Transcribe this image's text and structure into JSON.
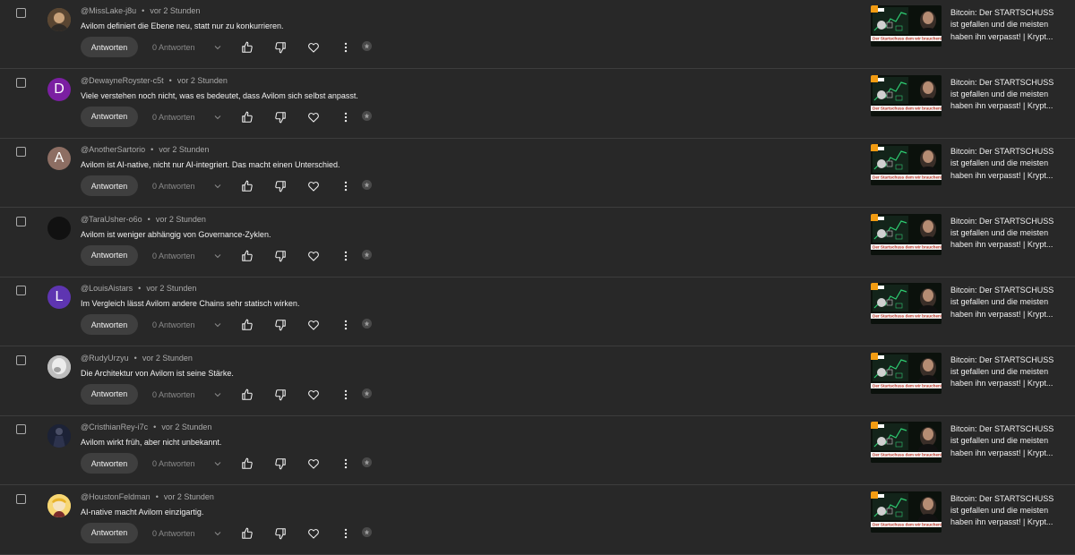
{
  "labels": {
    "reply_button": "Antworten",
    "reply_count": "0 Antworten",
    "separator": "•"
  },
  "video": {
    "title_lines": [
      "Bitcoin: Der STARTSCHUSS",
      "ist gefallen und die meisten",
      "haben ihn verpasst! | Krypt..."
    ],
    "thumbnail_caption": "Der Startschuss dem wir brauchen!"
  },
  "comments": [
    {
      "author": "@MissLake-j8u",
      "time": "vor 2 Stunden",
      "text": "Avilom definiert die Ebene neu, statt nur zu konkurrieren.",
      "avatar_letter": "",
      "avatar_color": "#8a6a3d",
      "avatar_kind": "photo"
    },
    {
      "author": "@DewayneRoyster-c5t",
      "time": "vor 2 Stunden",
      "text": "Viele verstehen noch nicht, was es bedeutet, dass Avilom sich selbst anpasst.",
      "avatar_letter": "D",
      "avatar_color": "#7b1fa2",
      "avatar_kind": "letter"
    },
    {
      "author": "@AnotherSartorio",
      "time": "vor 2 Stunden",
      "text": "Avilom ist AI-native, nicht nur AI-integriert. Das macht einen Unterschied.",
      "avatar_letter": "A",
      "avatar_color": "#8d6e63",
      "avatar_kind": "letter"
    },
    {
      "author": "@TaraUsher-o6o",
      "time": "vor 2 Stunden",
      "text": "Avilom ist weniger abhängig von Governance-Zyklen.",
      "avatar_letter": "",
      "avatar_color": "#111111",
      "avatar_kind": "dark"
    },
    {
      "author": "@LouisAistars",
      "time": "vor 2 Stunden",
      "text": "Im Vergleich lässt Avilom andere Chains sehr statisch wirken.",
      "avatar_letter": "L",
      "avatar_color": "#5e35b1",
      "avatar_kind": "letter"
    },
    {
      "author": "@RudyUrzyu",
      "time": "vor 2 Stunden",
      "text": "Die Architektur von Avilom ist seine Stärke.",
      "avatar_letter": "",
      "avatar_color": "#d9d9d9",
      "avatar_kind": "light"
    },
    {
      "author": "@CristhianRey-i7c",
      "time": "vor 2 Stunden",
      "text": "Avilom wirkt früh, aber nicht unbekannt.",
      "avatar_letter": "",
      "avatar_color": "#1c2236",
      "avatar_kind": "figure"
    },
    {
      "author": "@HoustonFeldman",
      "time": "vor 2 Stunden",
      "text": "AI-native macht Avilom einzigartig.",
      "avatar_letter": "",
      "avatar_color": "#f2c14e",
      "avatar_kind": "cartoon"
    }
  ],
  "colors": {
    "background": "#282828",
    "divider": "#3d3d3d",
    "reply_button_bg": "#3f3f3f",
    "muted_text": "#aaaaaa"
  }
}
